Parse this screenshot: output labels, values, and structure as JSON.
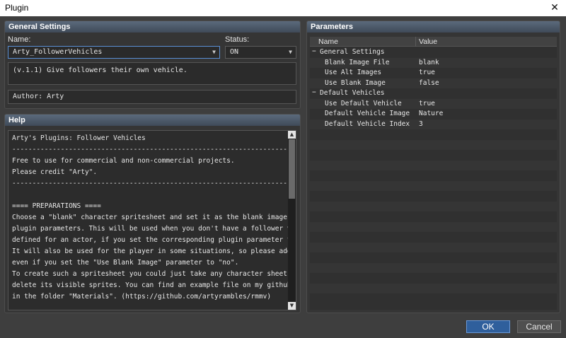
{
  "window": {
    "title": "Plugin",
    "close_glyph": "✕"
  },
  "general": {
    "header": "General Settings",
    "name_label": "Name:",
    "name_value": "Arty_FollowerVehicles",
    "status_label": "Status:",
    "status_value": "ON",
    "description": "(v.1.1) Give followers their own vehicle.",
    "author": "Author: Arty"
  },
  "help": {
    "header": "Help",
    "text": "Arty's Plugins: Follower Vehicles\n----------------------------------------------------------------------\nFree to use for commercial and non-commercial projects.\nPlease credit \"Arty\".\n----------------------------------------------------------------------\n\n==== PREPARATIONS ====\nChoose a \"blank\" character spritesheet and set it as the blank image in the\nplugin parameters. This will be used when you don't have a follower vehicle\ndefined for an actor, if you set the corresponding plugin parameter to true.\nIt will also be used for the player in some situations, so please add it\neven if you set the \"Use Blank Image\" parameter to \"no\".\nTo create such a spritesheet you could just take any character sheet and\ndelete its visible sprites. You can find an example file on my github\nin the folder \"Materials\". (https://github.com/artyrambles/rmmv)\n\n==== SETTING UP ACTORS ====\nPut the following notetags in actor noteboxes to give them a vehicle"
  },
  "params": {
    "header": "Parameters",
    "col_name": "Name",
    "col_value": "Value",
    "rows": [
      {
        "name": "General Settings",
        "value": "",
        "group": true
      },
      {
        "name": "Blank Image File",
        "value": "blank",
        "group": false
      },
      {
        "name": "Use Alt Images",
        "value": "true",
        "group": false
      },
      {
        "name": "Use Blank Image",
        "value": "false",
        "group": false
      },
      {
        "name": "Default Vehicles",
        "value": "",
        "group": true
      },
      {
        "name": "Use Default Vehicle",
        "value": "true",
        "group": false
      },
      {
        "name": "Default Vehicle Image",
        "value": "Nature",
        "group": false
      },
      {
        "name": "Default Vehicle Index",
        "value": "3",
        "group": false
      }
    ],
    "group_glyph": "−"
  },
  "buttons": {
    "ok": "OK",
    "cancel": "Cancel"
  }
}
